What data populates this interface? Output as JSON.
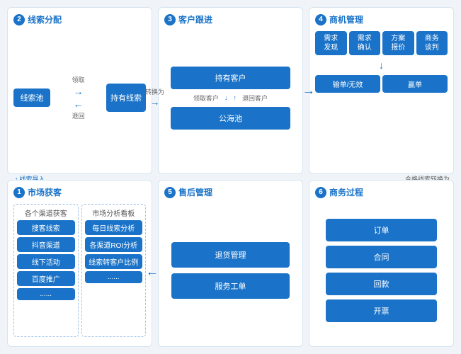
{
  "panels": {
    "panel1": {
      "num": "2",
      "title": "线索分配",
      "pool_label": "线索池",
      "owned_label": "持有线索",
      "take_label": "领取",
      "return_label": "退回",
      "convert_label": "转换为",
      "import_label": "线索导入"
    },
    "panel2": {
      "num": "3",
      "title": "客户跟进",
      "owned_customer": "持有客户",
      "public_pool": "公海池",
      "take_customer": "领取客户",
      "return_customer": "退回客户"
    },
    "panel3": {
      "num": "4",
      "title": "商机管理",
      "box1": "需求\n发现",
      "box2": "需求\n确认",
      "box3": "方案\n报价",
      "box4": "商务\n谈判",
      "box5": "输单/无效",
      "box6": "赢单",
      "convert_label": "合格线索转换为"
    },
    "panel4": {
      "num": "1",
      "title": "市场获客",
      "col1_title": "各个渠道获客",
      "col2_title": "市场分析看板",
      "col1_items": [
        "搜客线索",
        "抖音渠道",
        "线下活动",
        "百度推广",
        "......"
      ],
      "col2_items": [
        "每日线索分析",
        "各渠道ROI分析",
        "线索转客户比例",
        "......"
      ]
    },
    "panel5": {
      "num": "5",
      "title": "售后管理",
      "items": [
        "退货管理",
        "服务工单"
      ]
    },
    "panel6": {
      "num": "6",
      "title": "商务过程",
      "items": [
        "订单",
        "合同",
        "回款",
        "开票"
      ]
    }
  }
}
